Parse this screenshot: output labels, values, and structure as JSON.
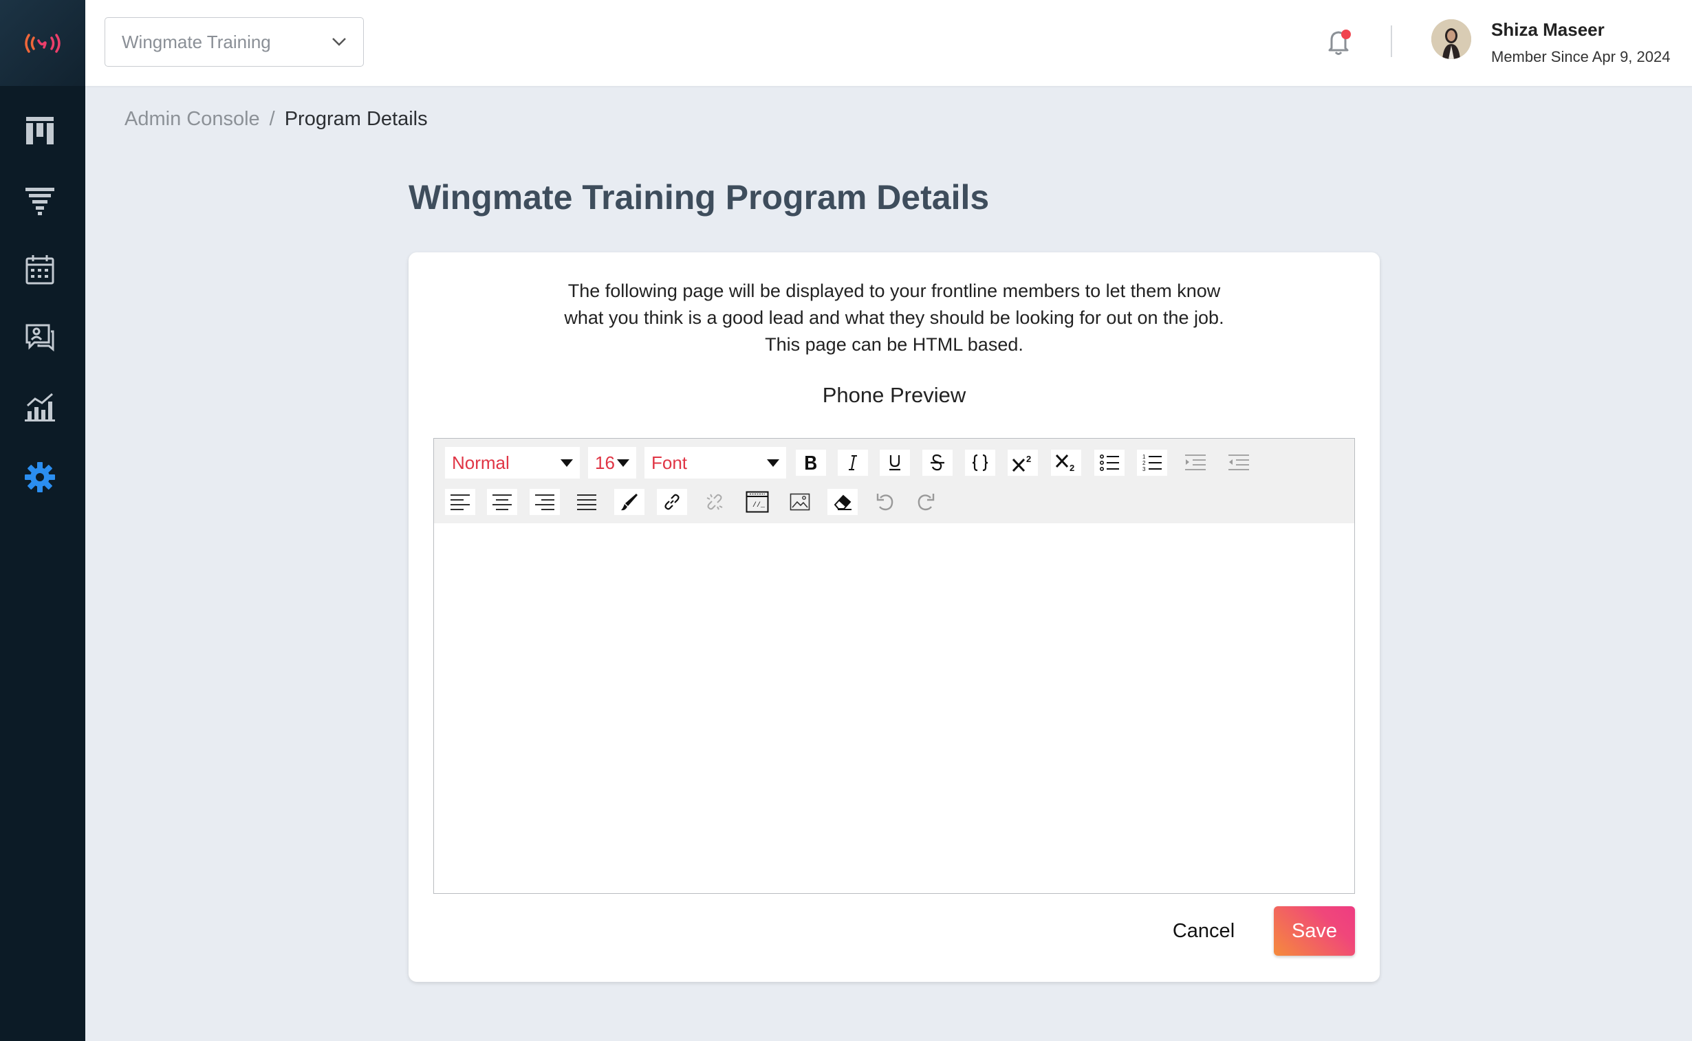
{
  "sidebar": {
    "logo": "signal-broadcast-logo",
    "items": [
      {
        "icon": "board-icon",
        "active": false
      },
      {
        "icon": "funnel-icon",
        "active": false
      },
      {
        "icon": "calendar-icon",
        "active": false
      },
      {
        "icon": "chat-users-icon",
        "active": false
      },
      {
        "icon": "analytics-icon",
        "active": false
      },
      {
        "icon": "settings-gear-icon",
        "active": true
      }
    ],
    "active_color": "#2b8ef0"
  },
  "topbar": {
    "program_select": {
      "value": "Wingmate Training"
    },
    "notification_dot_color": "#f0444f",
    "user": {
      "name": "Shiza Maseer",
      "since": "Member Since Apr 9, 2024"
    }
  },
  "breadcrumb": {
    "parent": "Admin Console",
    "separator": "/",
    "current": "Program Details"
  },
  "page": {
    "title": "Wingmate Training Program Details"
  },
  "card": {
    "description_lines": [
      "The following page will be displayed to your frontline members to let them know",
      "what you think is a good lead and what they should be looking for out on the job.",
      "This page can be HTML based."
    ],
    "preview_label": "Phone Preview"
  },
  "editor": {
    "heading_select": "Normal",
    "size_select": "16",
    "font_select": "Font",
    "content": ""
  },
  "actions": {
    "cancel": "Cancel",
    "save": "Save"
  }
}
